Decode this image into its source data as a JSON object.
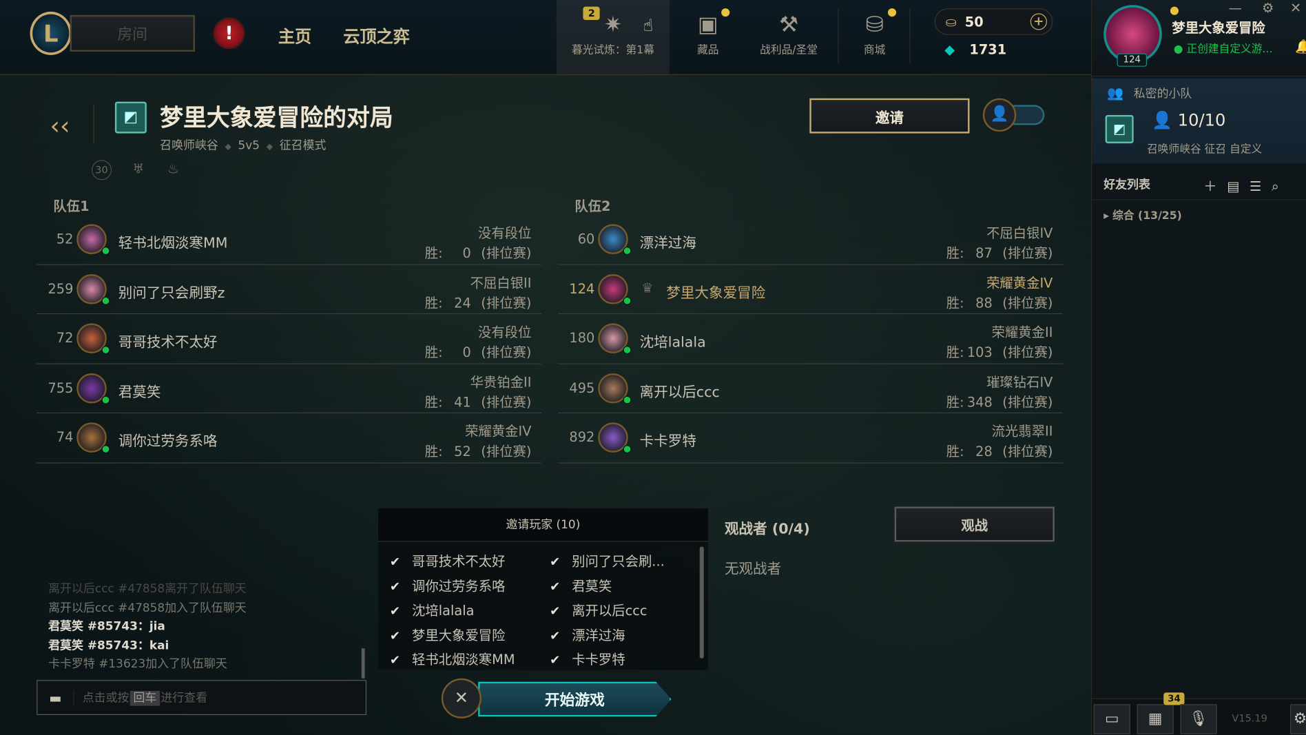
{
  "topbar": {
    "room_label": "房间",
    "alert_symbol": "!",
    "nav": [
      "主页",
      "云顶之弈"
    ],
    "twilight_badge": "2",
    "twilight_label": "暮光试炼：第1幕",
    "collection_label": "藏品",
    "loot_label": "战利品/圣堂",
    "store_label": "商城",
    "rp": "50",
    "be": "1731",
    "plus": "+"
  },
  "profile": {
    "name": "梦里大象爱冒险",
    "level": "124",
    "status": "正创建自定义游..."
  },
  "party": {
    "label": "私密的小队",
    "count": "10/10",
    "desc": "召唤师峡谷 征召 自定义"
  },
  "friends": {
    "title": "好友列表",
    "group": "综合 (13/25)"
  },
  "social_bottom": {
    "count_badge": "34",
    "version": "V15.19"
  },
  "lobby": {
    "title": "梦里大象爱冒险的对局",
    "map": "召唤师峡谷",
    "size": "5v5",
    "mode": "征召模式",
    "invite_button": "邀请",
    "timer_icon_text": "30"
  },
  "teams": [
    {
      "title": "队伍1",
      "players": [
        {
          "level": "52",
          "name": "轻书北烟淡寒MM",
          "rank": "没有段位",
          "wins_label": "胜:",
          "wins": "0",
          "queue": "(排位赛)",
          "color": "#c86aa8"
        },
        {
          "level": "259",
          "name": "别问了只会刷野z",
          "rank": "不屈白银II",
          "wins_label": "胜:",
          "wins": "24",
          "queue": "(排位赛)",
          "color": "#d88aa8"
        },
        {
          "level": "72",
          "name": "哥哥技术不太好",
          "rank": "没有段位",
          "wins_label": "胜:",
          "wins": "0",
          "queue": "(排位赛)",
          "color": "#c8603a"
        },
        {
          "level": "755",
          "name": "君莫笑",
          "rank": "华贵铂金II",
          "wins_label": "胜:",
          "wins": "41",
          "queue": "(排位赛)",
          "color": "#7a3aa8"
        },
        {
          "level": "74",
          "name": "调你过劳务系咯",
          "rank": "荣耀黄金IV",
          "wins_label": "胜:",
          "wins": "52",
          "queue": "(排位赛)",
          "color": "#a8703a"
        }
      ]
    },
    {
      "title": "队伍2",
      "players": [
        {
          "level": "60",
          "name": "漂洋过海",
          "rank": "不屈白银IV",
          "wins_label": "胜:",
          "wins": "87",
          "queue": "(排位赛)",
          "color": "#3a8ac8"
        },
        {
          "level": "124",
          "name": "梦里大象爱冒险",
          "rank": "荣耀黄金IV",
          "wins_label": "胜:",
          "wins": "88",
          "queue": "(排位赛)",
          "color": "#c83a7a",
          "self": true
        },
        {
          "level": "180",
          "name": "沈培lalala",
          "rank": "荣耀黄金II",
          "wins_label": "胜:",
          "wins": "103",
          "queue": "(排位赛)",
          "color": "#d89aa8"
        },
        {
          "level": "495",
          "name": "离开以后ccc",
          "rank": "璀璨钻石IV",
          "wins_label": "胜:",
          "wins": "348",
          "queue": "(排位赛)",
          "color": "#a87a5a"
        },
        {
          "level": "892",
          "name": "卡卡罗特",
          "rank": "流光翡翠II",
          "wins_label": "胜:",
          "wins": "28",
          "queue": "(排位赛)",
          "color": "#8a5ac8"
        }
      ]
    }
  ],
  "chat": {
    "lines": [
      {
        "text": "离开以后ccc #47858离开了队伍聊天",
        "kind": "faded"
      },
      {
        "text": "离开以后ccc #47858加入了队伍聊天",
        "kind": "sys"
      },
      {
        "text": "君莫笑 #85743：jia",
        "kind": "msg"
      },
      {
        "text": "君莫笑 #85743：kai",
        "kind": "msg"
      },
      {
        "text": "卡卡罗特 #13623加入了队伍聊天",
        "kind": "sys"
      }
    ],
    "placeholder_before": "点击或按",
    "placeholder_key": "回车",
    "placeholder_after": "进行查看"
  },
  "invite_list": {
    "title": "邀请玩家 (10)",
    "items": [
      "哥哥技术不太好",
      "别问了只会刷...",
      "调你过劳务系咯",
      "君莫笑",
      "沈培lalala",
      "离开以后ccc",
      "梦里大象爱冒险",
      "漂洋过海",
      "轻书北烟淡寒MM",
      "卡卡罗特"
    ]
  },
  "start": {
    "label": "开始游戏",
    "cancel": "✕"
  },
  "spectators": {
    "title": "观战者 (0/4)",
    "empty": "无观战者",
    "button": "观战"
  },
  "colors": {
    "gold": "#c8aa6e",
    "teal": "#0ac8b9",
    "online": "#1dc04a"
  }
}
